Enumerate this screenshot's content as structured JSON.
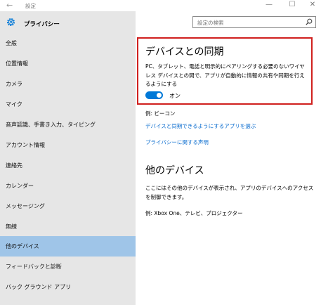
{
  "titlebar": {
    "back": "←",
    "title": "設定",
    "minimize": "—",
    "maximize": "☐",
    "close": "✕"
  },
  "sidebar": {
    "title": "プライバシー",
    "items": [
      {
        "label": "全般"
      },
      {
        "label": "位置情報"
      },
      {
        "label": "カメラ"
      },
      {
        "label": "マイク"
      },
      {
        "label": "音声認識、手書き入力、タイピング"
      },
      {
        "label": "アカウント情報"
      },
      {
        "label": "連絡先"
      },
      {
        "label": "カレンダー"
      },
      {
        "label": "メッセージング"
      },
      {
        "label": "無線"
      },
      {
        "label": "他のデバイス",
        "selected": true
      },
      {
        "label": "フィードバックと診断"
      },
      {
        "label": "バック グラウンド アプリ"
      }
    ]
  },
  "search": {
    "placeholder": "設定の検索"
  },
  "sync": {
    "heading": "デバイスとの同期",
    "description": "PC、タブレット、電話と明示的にペアリングする必要のないワイヤレス デバイスとの間で、アプリが自動的に情報の共有や同期を行えるようにする",
    "toggle_state": "on",
    "toggle_label": "オン",
    "example": "例: ビーコン",
    "link_choose": "デバイスと同期できるようにするアプリを選ぶ",
    "link_privacy": "プライバシーに関する声明"
  },
  "other": {
    "heading": "他のデバイス",
    "description": "ここにはその他のデバイスが表示され、アプリのデバイスへのアクセスを制御できます。",
    "example": "例: Xbox One、テレビ、プロジェクター"
  },
  "colors": {
    "accent": "#0078d7",
    "link": "#0a6ccf",
    "highlight": "#d0201e",
    "sidebar_bg": "#e6e6e6",
    "selected_bg": "#9fc5e8"
  }
}
